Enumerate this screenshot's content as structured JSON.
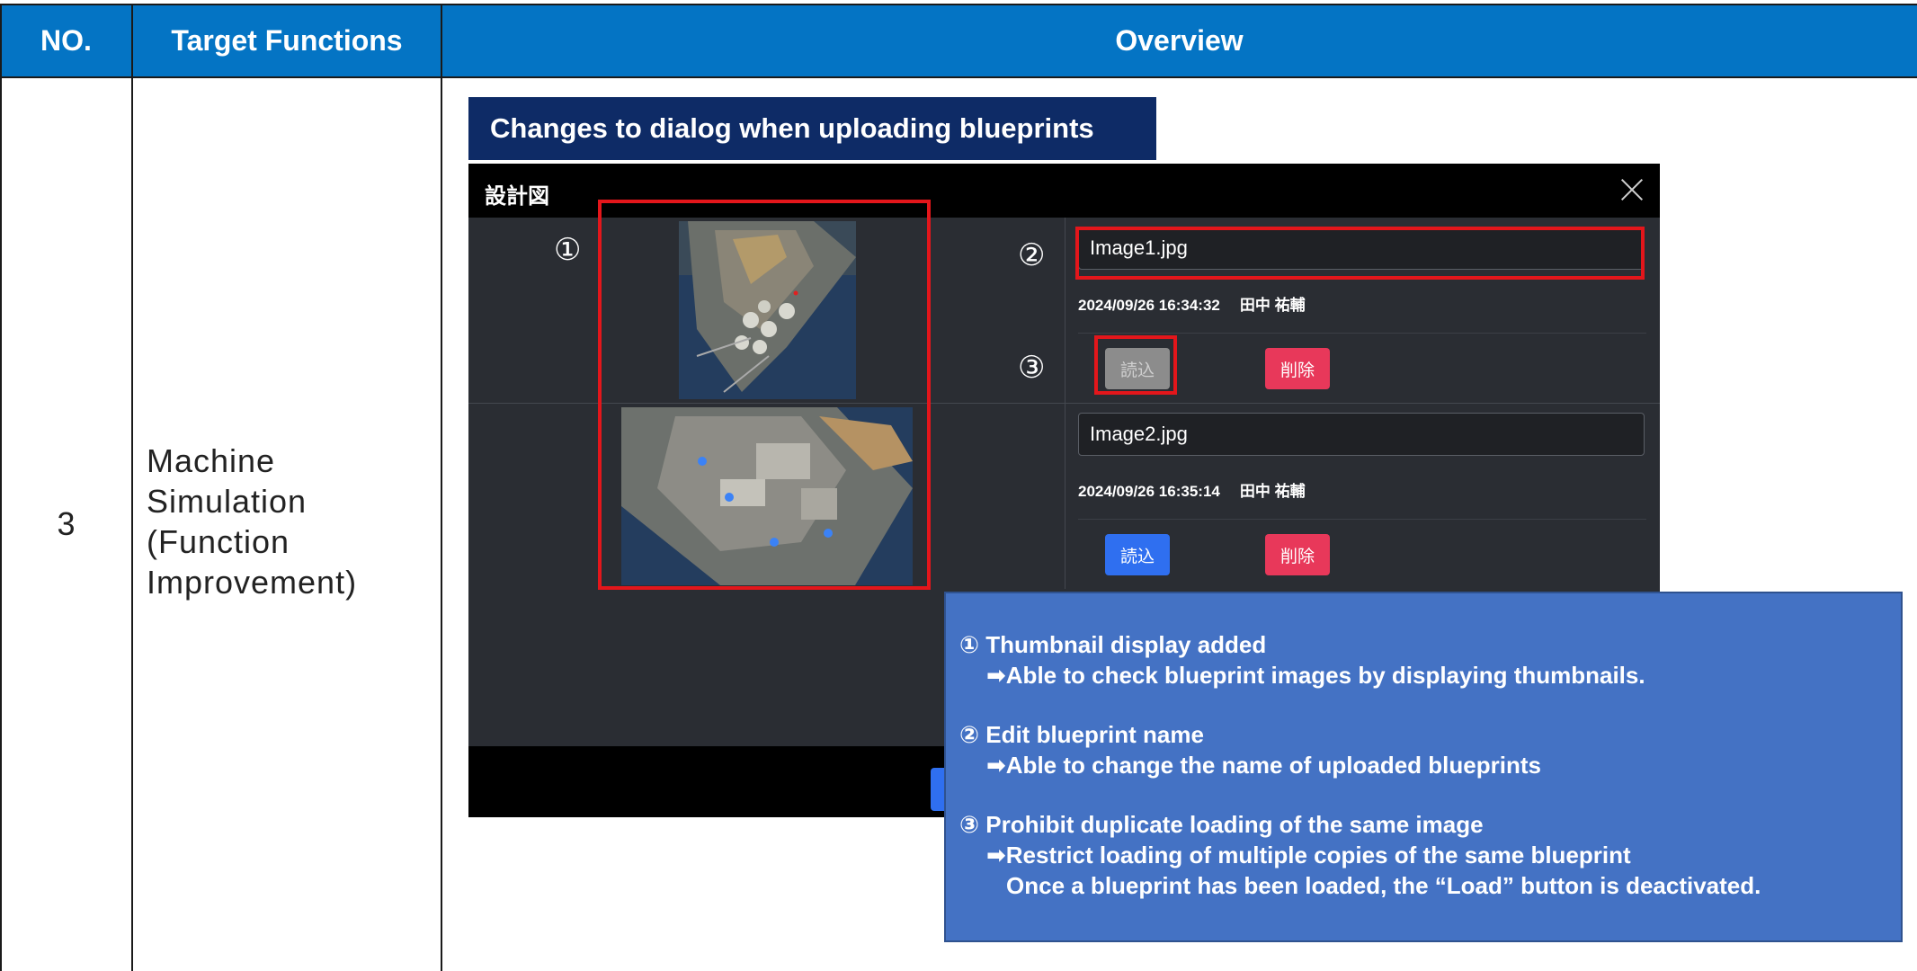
{
  "table": {
    "headers": {
      "no": "NO.",
      "target": "Target Functions",
      "overview": "Overview"
    },
    "row": {
      "no": "3",
      "function": "Machine\nSimulation\n(Function\nImprovement)"
    }
  },
  "section_title": "Changes to dialog when uploading blueprints",
  "dialog": {
    "title": "設計図",
    "items": [
      {
        "name": "Image1.jpg",
        "datetime": "2024/09/26 16:34:32",
        "user": "田中 祐輔",
        "load_label": "読込",
        "load_disabled": true,
        "delete_label": "削除"
      },
      {
        "name": "Image2.jpg",
        "datetime": "2024/09/26 16:35:14",
        "user": "田中 祐輔",
        "load_label": "読込",
        "load_disabled": false,
        "delete_label": "削除"
      }
    ]
  },
  "markers": {
    "m1": "①",
    "m2": "②",
    "m3": "③"
  },
  "callout": {
    "item1_title": "① Thumbnail display added",
    "item1_desc": "➡Able to check blueprint images by displaying thumbnails.",
    "item2_title": "② Edit blueprint name",
    "item2_desc": "➡Able to change the name of uploaded blueprints",
    "item3_title": "③ Prohibit duplicate loading of the same image",
    "item3_desc": "➡Restrict loading of multiple copies of the same blueprint",
    "item3_desc2": "Once a blueprint has been loaded, the “Load” button is deactivated."
  },
  "colors": {
    "header_bg": "#0474c4",
    "section_title_bg": "#0e2b66",
    "dialog_bg": "#2a2d33",
    "highlight": "#e3161b",
    "load_button": "#2f6ff0",
    "delete_button": "#e8385a",
    "callout_bg": "#4472c4"
  }
}
